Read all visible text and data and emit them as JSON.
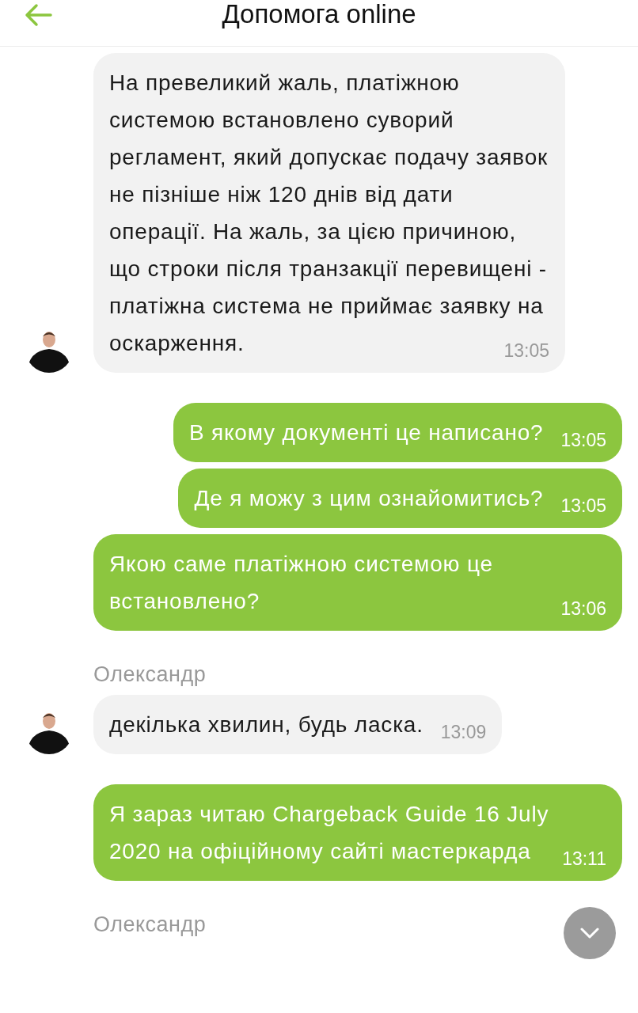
{
  "header": {
    "title": "Допомога online"
  },
  "messages": [
    {
      "kind": "incoming",
      "avatar": true,
      "text": "На превеликий жаль, платіжною системою встановлено суворий регламент, який допускає подачу заявок не пізніше ніж 120 днів від дати операції. На жаль, за цією причиною, що строки після транзакції перевищені - платіжна система не приймає заявку на оскарження.",
      "time": "13:05"
    },
    {
      "kind": "outgoing",
      "text": "В якому документі це написано?",
      "time": "13:05"
    },
    {
      "kind": "outgoing",
      "text": "Де я можу з цим ознайомитись?",
      "time": "13:05"
    },
    {
      "kind": "outgoing",
      "text": "Якою саме платіжною системою це встановлено?",
      "time": "13:06"
    },
    {
      "kind": "incoming",
      "sender": "Олександр",
      "avatar": true,
      "text": "декілька хвилин, будь ласка.",
      "time": "13:09"
    },
    {
      "kind": "outgoing",
      "text": "Я зараз читаю Chargeback Guide 16 July 2020 на офіційному сайті мастеркарда",
      "time": "13:11"
    },
    {
      "kind": "incoming",
      "sender": "Олександр"
    }
  ]
}
